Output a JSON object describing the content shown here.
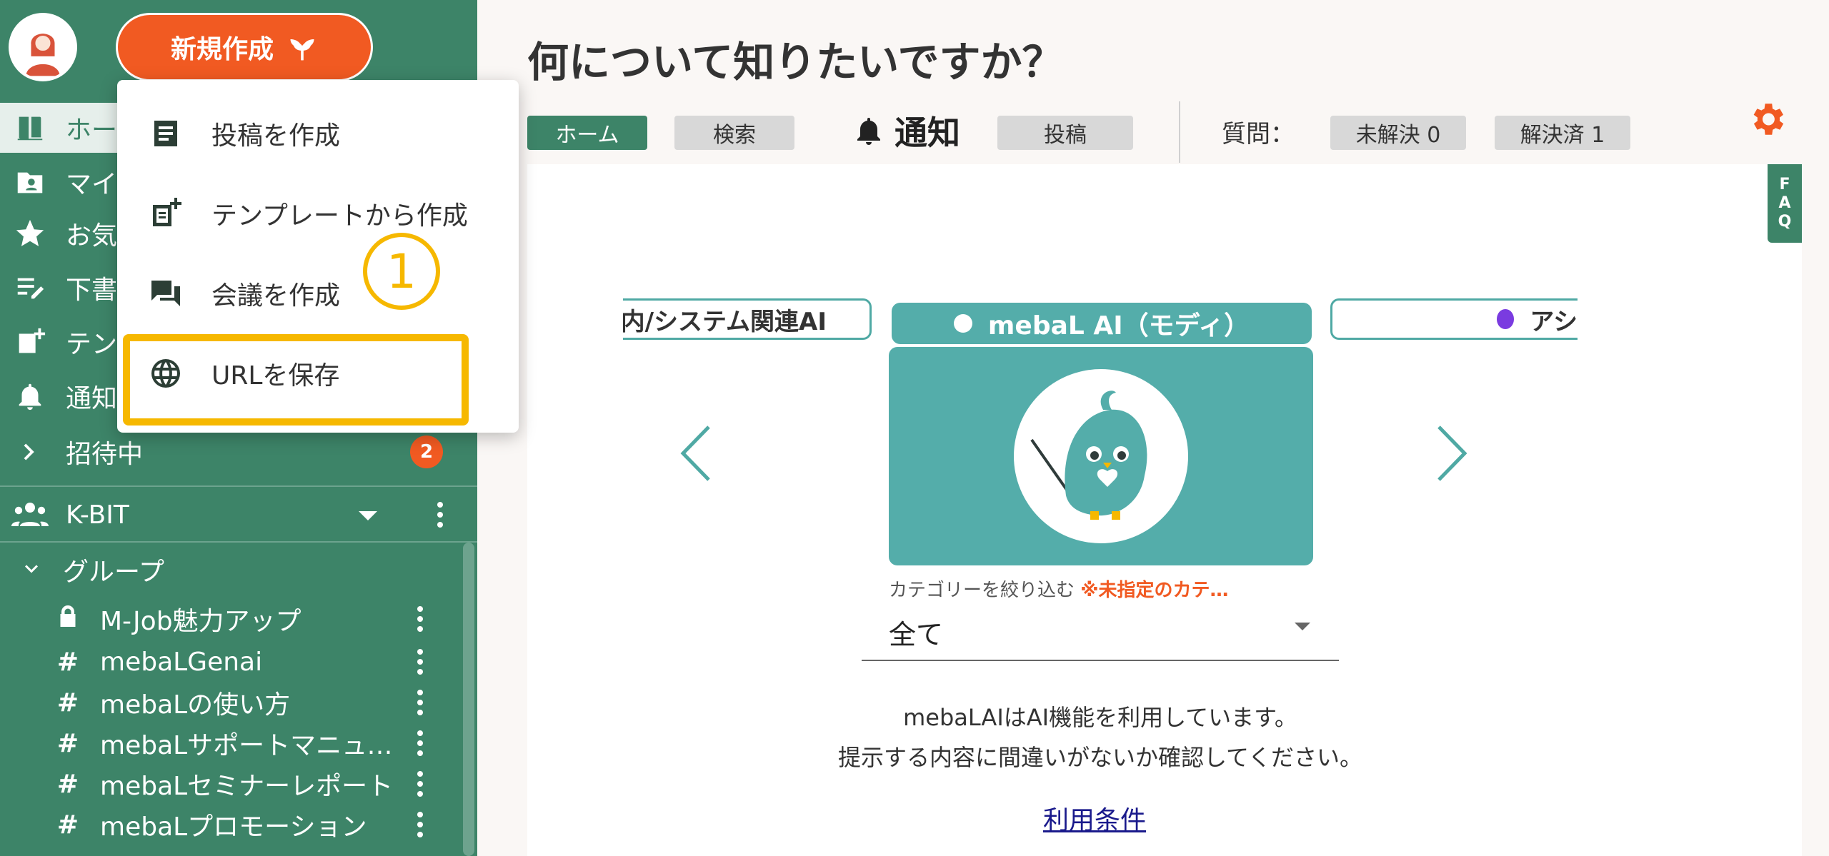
{
  "sidebar": {
    "new_button_label": "新規作成",
    "nav_items": [
      {
        "label": "ホーム",
        "icon": "book-icon"
      },
      {
        "label": "マイページ",
        "icon": "contact-folder-icon"
      },
      {
        "label": "お気に入り",
        "icon": "star-icon"
      },
      {
        "label": "下書き",
        "icon": "draft-icon"
      },
      {
        "label": "テンプレート",
        "icon": "template-icon"
      },
      {
        "label": "通知",
        "icon": "bell-icon"
      },
      {
        "label": "招待中",
        "icon": "chevron-right-icon",
        "badge": "2"
      }
    ],
    "workspace": "K-BIT",
    "group_header": "グループ",
    "channels": [
      {
        "prefix": "lock",
        "name": "M-Job魅力アップ"
      },
      {
        "prefix": "#",
        "name": "mebaLGenai"
      },
      {
        "prefix": "#",
        "name": "mebaLの使い方"
      },
      {
        "prefix": "#",
        "name": "mebaLサポートマニュアル"
      },
      {
        "prefix": "#",
        "name": "mebaLセミナーレポート"
      },
      {
        "prefix": "#",
        "name": "mebaLプロモーション"
      }
    ]
  },
  "dropdown": {
    "items": [
      {
        "label": "投稿を作成",
        "icon": "post-icon"
      },
      {
        "label": "テンプレートから作成",
        "icon": "template-add-icon"
      },
      {
        "label": "会議を作成",
        "icon": "chat-icon"
      },
      {
        "label": "URLを保存",
        "icon": "globe-icon"
      }
    ],
    "step_marker": "1"
  },
  "main": {
    "title": "何について知りたいですか？",
    "tabs": {
      "home": "ホーム",
      "search": "検索",
      "notice": "通知",
      "post": "投稿",
      "question_label": "質問：",
      "unresolved": "未解決 0",
      "resolved": "解決済 1"
    },
    "faq": [
      "F",
      "A",
      "Q"
    ],
    "carousel": {
      "left_card": "内/システム関連AI",
      "center_card": "mebaL AI（モディ）",
      "right_card": "アシ"
    },
    "filter": {
      "label": "カテゴリーを絞り込む",
      "warning": "※未指定のカテ…",
      "selected": "全て"
    },
    "info_line1": "mebaLAIはAI機能を利用しています。",
    "info_line2": "提示する内容に間違いがないか確認してください。",
    "terms_link": "利用条件"
  },
  "colors": {
    "sidebar_bg": "#3d8468",
    "accent_orange": "#f15a22",
    "teal": "#54adaa",
    "highlight_yellow": "#f6b800"
  }
}
